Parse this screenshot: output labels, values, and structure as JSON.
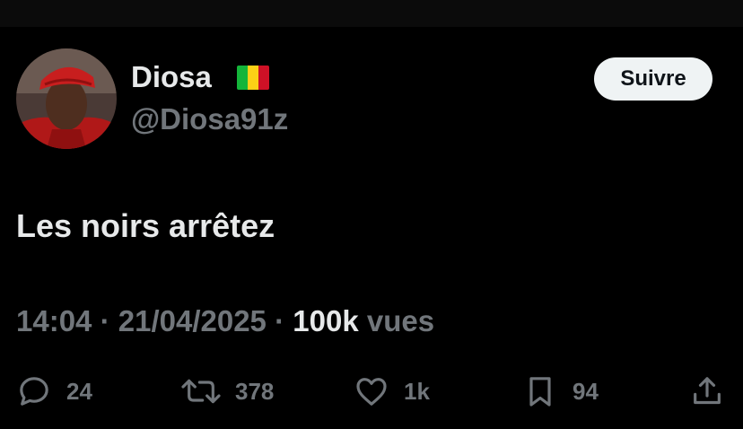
{
  "tweet": {
    "author": {
      "display_name": "Diosa",
      "flag": {
        "name": "mali-flag",
        "colors": [
          "#14b53a",
          "#fcd116",
          "#ce1126"
        ]
      },
      "handle": "@Diosa91z"
    },
    "follow_label": "Suivre",
    "text": "Les noirs arrêtez",
    "time": "14:04",
    "date": "21/04/2025",
    "views_count": "100k",
    "views_label": "vues",
    "separator": "·",
    "stats": {
      "replies": "24",
      "reposts": "378",
      "likes": "1k",
      "bookmarks": "94"
    }
  },
  "icons": {
    "reply": "reply-icon",
    "repost": "repost-icon",
    "like": "like-icon",
    "bookmark": "bookmark-icon",
    "share": "share-icon"
  },
  "colors": {
    "background": "#000000",
    "text_primary": "#e7e9ea",
    "text_secondary": "#71767b",
    "button_bg": "#eff3f4",
    "button_text": "#0f1419"
  }
}
